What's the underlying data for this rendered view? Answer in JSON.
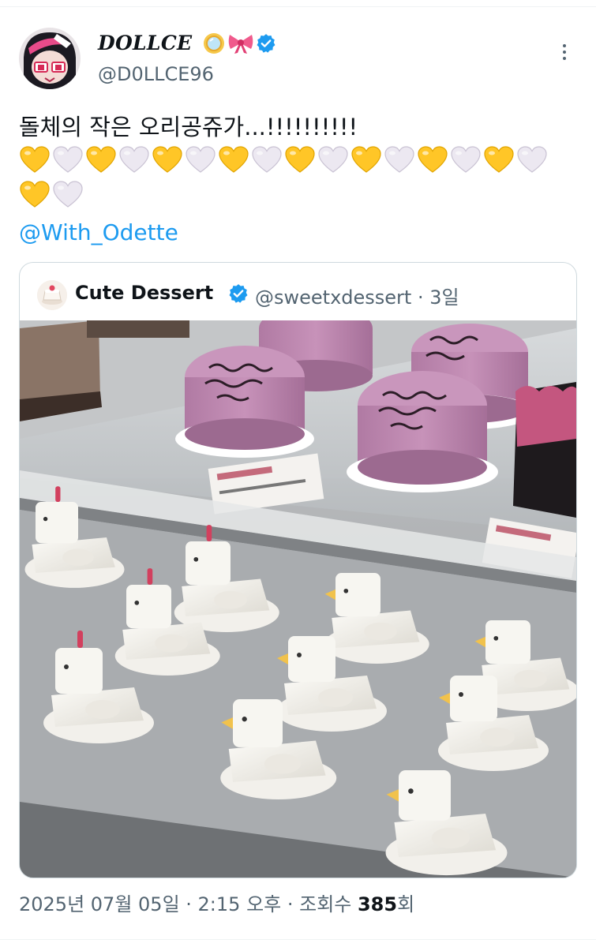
{
  "author": {
    "name": "DOLLCE",
    "handle": "@D0LLCE96",
    "name_icons": [
      "mirror-icon",
      "ribbon-bow-icon",
      "verified-badge-icon"
    ]
  },
  "tweet": {
    "text": "돌체의 작은 오리공쥬가...!!!!!!!!!!",
    "heart_rows": [
      [
        "yellow",
        "white",
        "yellow",
        "white",
        "yellow",
        "white",
        "yellow",
        "white",
        "yellow",
        "white",
        "yellow",
        "white",
        "yellow",
        "white",
        "yellow",
        "white"
      ],
      [
        "yellow",
        "white"
      ]
    ],
    "mention": "@With_Odette"
  },
  "quote": {
    "name": "Cute Dessert",
    "handle": "@sweetxdessert",
    "time": "3일",
    "handle_time": "@sweetxdessert · 3일",
    "photo_description_icon": "cake-display-photo"
  },
  "footer": {
    "date_time_views_prefix": "2025년 07월 05일 · 2:15 오후 · 조회수 ",
    "views": "385",
    "views_suffix": "회"
  },
  "colors": {
    "link": "#1d9bf0",
    "verified": "#1d9bf0",
    "secondary_text": "#536471",
    "heart_yellow": "#ffc627",
    "heart_white": "#ece8f1"
  }
}
